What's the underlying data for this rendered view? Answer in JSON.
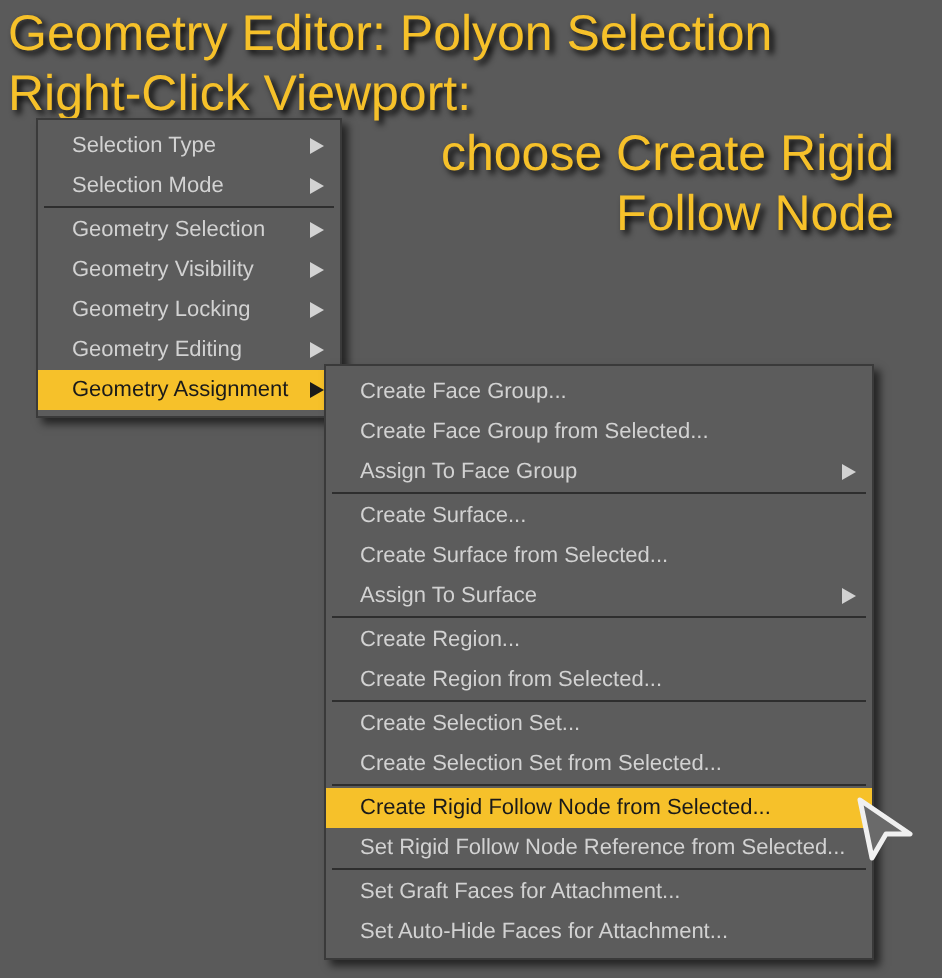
{
  "caption": {
    "title_lines": [
      "Geometry Editor: Polyon Selection",
      "Right-Click Viewport:"
    ],
    "instruction_lines": [
      "choose Create Rigid",
      "Follow Node"
    ]
  },
  "context_menu": {
    "groups": [
      [
        {
          "label": "Selection Type",
          "submenu": true,
          "selected": false
        },
        {
          "label": "Selection Mode",
          "submenu": true,
          "selected": false
        }
      ],
      [
        {
          "label": "Geometry Selection",
          "submenu": true,
          "selected": false
        },
        {
          "label": "Geometry Visibility",
          "submenu": true,
          "selected": false
        },
        {
          "label": "Geometry Locking",
          "submenu": true,
          "selected": false
        },
        {
          "label": "Geometry Editing",
          "submenu": true,
          "selected": false
        },
        {
          "label": "Geometry Assignment",
          "submenu": true,
          "selected": true
        }
      ]
    ]
  },
  "submenu": {
    "groups": [
      [
        {
          "label": "Create Face Group...",
          "submenu": false,
          "selected": false
        },
        {
          "label": "Create Face Group from Selected...",
          "submenu": false,
          "selected": false
        },
        {
          "label": "Assign To Face Group",
          "submenu": true,
          "selected": false
        }
      ],
      [
        {
          "label": "Create Surface...",
          "submenu": false,
          "selected": false
        },
        {
          "label": "Create Surface from Selected...",
          "submenu": false,
          "selected": false
        },
        {
          "label": "Assign To Surface",
          "submenu": true,
          "selected": false
        }
      ],
      [
        {
          "label": "Create Region...",
          "submenu": false,
          "selected": false
        },
        {
          "label": "Create Region from Selected...",
          "submenu": false,
          "selected": false
        }
      ],
      [
        {
          "label": "Create Selection Set...",
          "submenu": false,
          "selected": false
        },
        {
          "label": "Create Selection Set from Selected...",
          "submenu": false,
          "selected": false
        }
      ],
      [
        {
          "label": "Create Rigid Follow Node from Selected...",
          "submenu": false,
          "selected": true
        },
        {
          "label": "Set Rigid Follow Node Reference from Selected...",
          "submenu": false,
          "selected": false
        }
      ],
      [
        {
          "label": "Set Graft Faces for Attachment...",
          "submenu": false,
          "selected": false
        },
        {
          "label": "Set Auto-Hide Faces for Attachment...",
          "submenu": false,
          "selected": false
        }
      ]
    ]
  }
}
